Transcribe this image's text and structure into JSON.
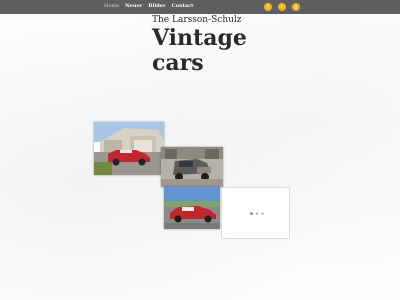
{
  "nav": {
    "items": [
      {
        "label": "Home",
        "active": true
      },
      {
        "label": "Neuer",
        "active": false
      },
      {
        "label": "Bilder",
        "active": false
      },
      {
        "label": "Contact",
        "active": false
      }
    ]
  },
  "social": {
    "icons": [
      {
        "name": "facebook-icon",
        "glyph": "f"
      },
      {
        "name": "twitter-icon",
        "glyph": "t"
      },
      {
        "name": "google-plus-icon",
        "glyph": "g"
      }
    ],
    "color": "#f0b31c"
  },
  "header": {
    "subtitle": "The Larsson-Schulz",
    "title": "Vintage cars"
  },
  "colors": {
    "topbar": "#5f5f5f",
    "text": "#2a2a2a",
    "car_red": "#c0262b"
  }
}
